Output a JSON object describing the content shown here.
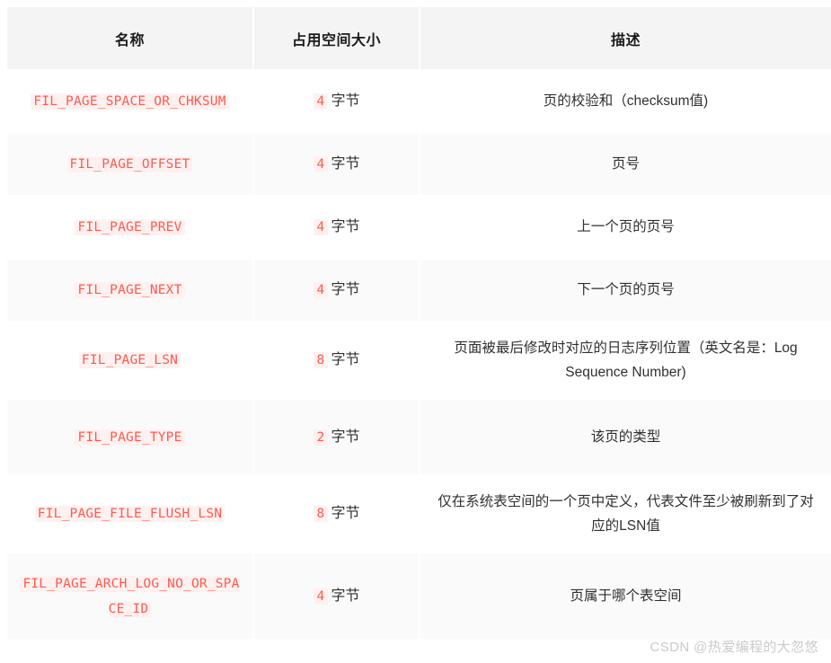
{
  "table": {
    "columns": [
      {
        "key": "name",
        "label": "名称"
      },
      {
        "key": "size",
        "label": "占用空间大小"
      },
      {
        "key": "desc",
        "label": "描述"
      }
    ],
    "rows": [
      {
        "name": "FIL_PAGE_SPACE_OR_CHKSUM",
        "size_value": "4",
        "size_unit": "字节",
        "desc": "页的校验和（checksum值)"
      },
      {
        "name": "FIL_PAGE_OFFSET",
        "size_value": "4",
        "size_unit": "字节",
        "desc": "页号"
      },
      {
        "name": "FIL_PAGE_PREV",
        "size_value": "4",
        "size_unit": "字节",
        "desc": "上一个页的页号"
      },
      {
        "name": "FIL_PAGE_NEXT",
        "size_value": "4",
        "size_unit": "字节",
        "desc": "下一个页的页号"
      },
      {
        "name": "FIL_PAGE_LSN",
        "size_value": "8",
        "size_unit": "字节",
        "desc": "页面被最后修改时对应的日志序列位置（英文名是：Log Sequence Number)"
      },
      {
        "name": "FIL_PAGE_TYPE",
        "size_value": "2",
        "size_unit": "字节",
        "desc": "该页的类型"
      },
      {
        "name": "FIL_PAGE_FILE_FLUSH_LSN",
        "size_value": "8",
        "size_unit": "字节",
        "desc": "仅在系统表空间的一个页中定义，代表文件至少被刷新到了对应的LSN值"
      },
      {
        "name": "FIL_PAGE_ARCH_LOG_NO_OR_SPACE_ID",
        "size_value": "4",
        "size_unit": "字节",
        "desc": "页属于哪个表空间"
      }
    ]
  },
  "watermark": {
    "text": "CSDN @热爱编程的大忽悠"
  },
  "colors": {
    "code_text": "#fb5b50",
    "code_background": "#fff1f0",
    "header_background": "#f4f4f5",
    "row_even_background": "#fafafa",
    "row_odd_background": "#ffffff",
    "body_text": "#2f3032",
    "watermark_text": "#c9cacc"
  }
}
